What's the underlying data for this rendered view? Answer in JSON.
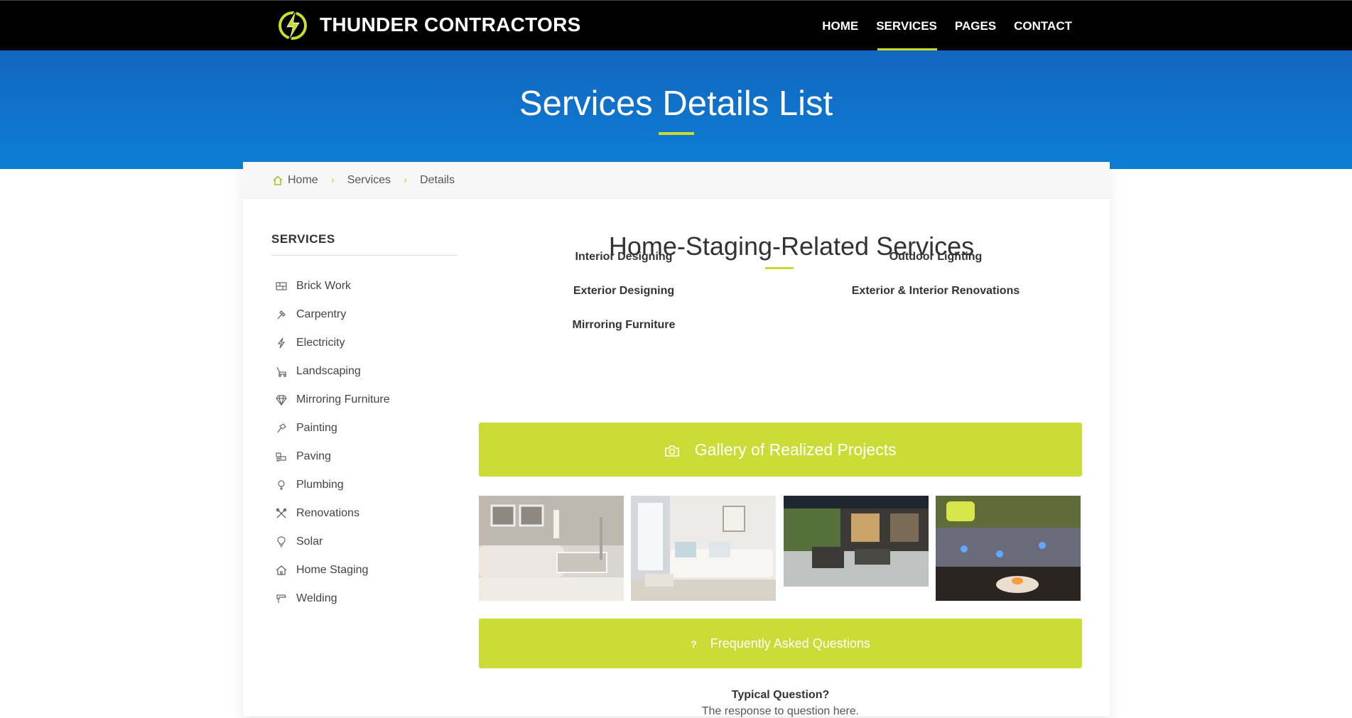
{
  "brand": {
    "name": "THUNDER CONTRACTORS"
  },
  "nav": {
    "items": [
      "HOME",
      "SERVICES",
      "PAGES",
      "CONTACT"
    ],
    "active": "SERVICES"
  },
  "hero": {
    "title": "Services Details List"
  },
  "breadcrumb": {
    "items": [
      "Home",
      "Services",
      "Details"
    ]
  },
  "sidebar": {
    "title": "SERVICES",
    "items": [
      {
        "label": "Brick Work",
        "icon": "brick-icon"
      },
      {
        "label": "Carpentry",
        "icon": "hammer-icon"
      },
      {
        "label": "Electricity",
        "icon": "bolt-icon"
      },
      {
        "label": "Landscaping",
        "icon": "lawnmower-icon"
      },
      {
        "label": "Mirroring Furniture",
        "icon": "diamond-icon"
      },
      {
        "label": "Painting",
        "icon": "paint-roller-icon"
      },
      {
        "label": "Paving",
        "icon": "paving-icon"
      },
      {
        "label": "Plumbing",
        "icon": "faucet-icon"
      },
      {
        "label": "Renovations",
        "icon": "tools-icon"
      },
      {
        "label": "Solar",
        "icon": "lightbulb-icon"
      },
      {
        "label": "Home Staging",
        "icon": "house-icon"
      },
      {
        "label": "Welding",
        "icon": "welding-icon"
      }
    ]
  },
  "main": {
    "title": "Home-Staging-Related Services",
    "services": {
      "interior": "Interior Designing",
      "outdoor": "Outdoor Lighting",
      "exterior": "Exterior Designing",
      "renovations": "Exterior & Interior Renovations",
      "mirroring": "Mirroring Furniture"
    },
    "gallery_label": "Gallery of Realized Projects",
    "faq_label": "Frequently Asked Questions",
    "faq": {
      "question": "Typical Question?",
      "answer": "The response to question here."
    }
  },
  "colors": {
    "accent": "#cbdc36",
    "hero_top": "#1266c0",
    "hero_bottom": "#0d7ed3",
    "nav_bg": "#000000"
  }
}
